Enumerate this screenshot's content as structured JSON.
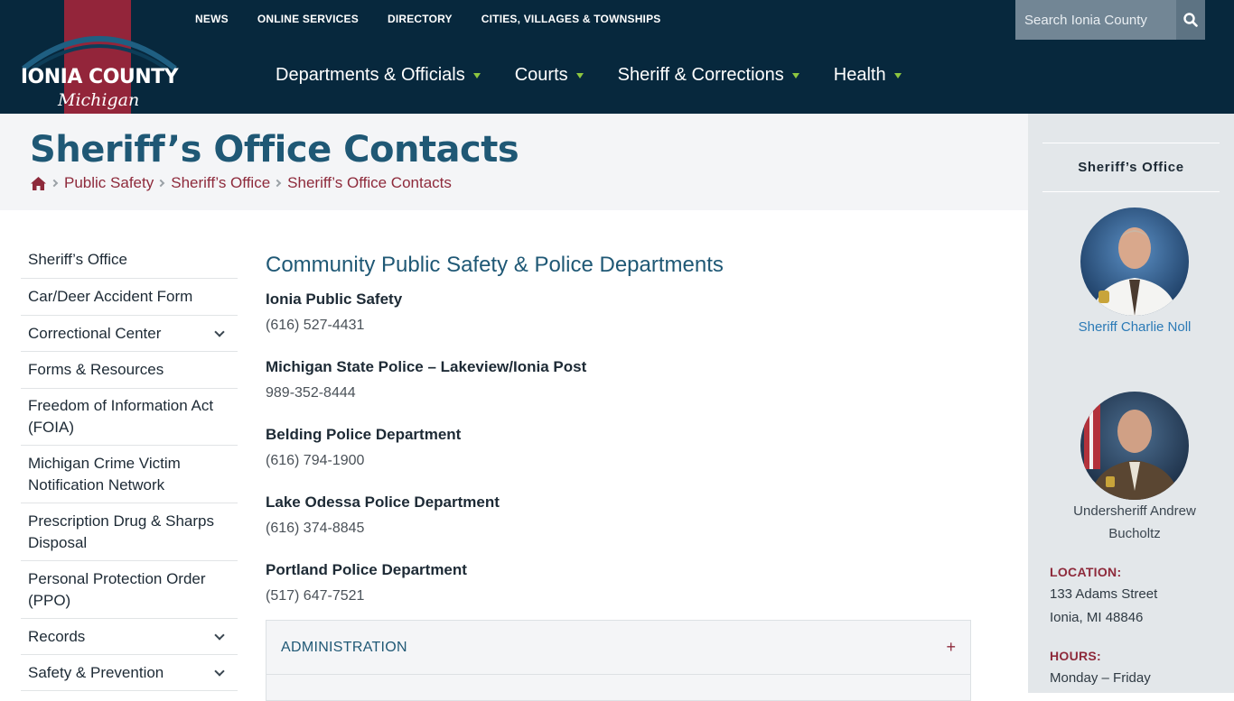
{
  "logo": {
    "name": "IONIA COUNTY",
    "sub": "Michigan"
  },
  "utility_nav": [
    "NEWS",
    "ONLINE SERVICES",
    "DIRECTORY",
    "CITIES, VILLAGES & TOWNSHIPS"
  ],
  "search": {
    "placeholder": "Search Ionia County",
    "icon": "search-icon"
  },
  "main_nav": [
    "Departments & Officials",
    "Courts",
    "Sheriff & Corrections",
    "Health"
  ],
  "page": {
    "title": "Sheriff’s Office Contacts",
    "breadcrumb": [
      "Public Safety",
      "Sheriff’s Office",
      "Sheriff’s Office Contacts"
    ]
  },
  "side_nav": [
    {
      "label": "Sheriff’s Office",
      "expandable": false
    },
    {
      "label": "Car/Deer Accident Form",
      "expandable": false
    },
    {
      "label": "Correctional Center",
      "expandable": true
    },
    {
      "label": "Forms & Resources",
      "expandable": false
    },
    {
      "label": "Freedom of Information Act (FOIA)",
      "expandable": false
    },
    {
      "label": "Michigan Crime Victim Notification Network",
      "expandable": false
    },
    {
      "label": "Prescription Drug & Sharps Disposal",
      "expandable": false
    },
    {
      "label": "Personal Protection Order (PPO)",
      "expandable": false
    },
    {
      "label": "Records",
      "expandable": true
    },
    {
      "label": "Safety & Prevention",
      "expandable": true
    }
  ],
  "content": {
    "heading": "Community Public Safety & Police Departments",
    "departments": [
      {
        "name": "Ionia Public Safety",
        "phone": "(616) 527-4431"
      },
      {
        "name": "Michigan State Police – Lakeview/Ionia Post",
        "phone": "989-352-8444"
      },
      {
        "name": "Belding Police Department",
        "phone": "(616) 794-1900"
      },
      {
        "name": "Lake Odessa Police Department",
        "phone": "(616) 374-8845"
      },
      {
        "name": "Portland Police Department",
        "phone": "(517) 647-7521"
      }
    ],
    "accordion": {
      "title": "ADMINISTRATION",
      "toggle": "+"
    }
  },
  "aside": {
    "heading": "Sheriff’s Office",
    "sheriff": "Sheriff Charlie Noll",
    "undersheriff_line1": "Undersheriff Andrew",
    "undersheriff_line2": "Bucholtz",
    "location_label": "LOCATION:",
    "address1": "133 Adams Street",
    "address2": "Ionia, MI 48846",
    "hours_label": "HOURS:",
    "hours1": "Monday – Friday"
  },
  "colors": {
    "header": "#07283d",
    "brand_red": "#93253a",
    "title_blue": "#1f5875",
    "accent_green": "#8dc63f",
    "link_red": "#8e2a3b"
  }
}
